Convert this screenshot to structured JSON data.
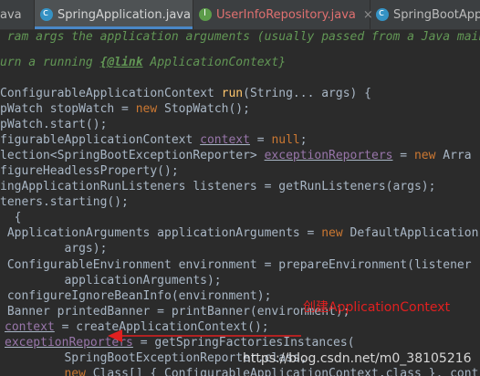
{
  "tabs": [
    {
      "label": "ava",
      "active": false
    },
    {
      "label": "SpringApplication.java",
      "active": true,
      "close": "×"
    },
    {
      "label": "UserInfoRepository.java",
      "active": false,
      "close": "×"
    },
    {
      "label": "SpringBootApplic",
      "active": false
    }
  ],
  "code": {
    "l0": {
      "a": " ram args the application arguments (usually passed from a Java main"
    },
    "l1": {
      "a": "urn a running ",
      "b": "{@link",
      "c": " ApplicationContext}"
    },
    "l2": {
      "a": "ConfigurableApplicationContext ",
      "b": "run",
      "c": "(String... args) {"
    },
    "l3": {
      "a": "pWatch stopWatch = ",
      "b": "new",
      "c": " StopWatch();"
    },
    "l4": {
      "a": "pWatch.start();"
    },
    "l5": {
      "a": "figurableApplicationContext ",
      "b": "context",
      "c": " = ",
      "d": "null",
      "e": ";"
    },
    "l6": {
      "a": "lection<SpringBootExceptionReporter> ",
      "b": "exceptionReporters",
      "c": " = ",
      "d": "new",
      "e": " Arra"
    },
    "l7": {
      "a": "figureHeadlessProperty();"
    },
    "l8": {
      "a": "ingApplicationRunListeners listeners = getRunListeners(args);"
    },
    "l9": {
      "a": "teners.starting();"
    },
    "l10": {
      "a": "  {"
    },
    "l11": {
      "a": " ApplicationArguments applicationArguments = ",
      "b": "new",
      "c": " DefaultApplication"
    },
    "l12": {
      "a": "         args);"
    },
    "l13": {
      "a": " ConfigurableEnvironment environment = prepareEnvironment(listener"
    },
    "l14": {
      "a": "         applicationArguments);"
    },
    "l15": {
      "a": " configureIgnoreBeanInfo(environment);"
    },
    "l16": {
      "a": " Banner printedBanner = printBanner(environment);"
    },
    "l17": {
      "a": "context",
      "b": " = createApplicationContext();"
    },
    "l18": {
      "a": "exceptionReporters",
      "b": " = getSpringFactoriesInstances("
    },
    "l19": {
      "a": "         SpringBootExceptionReporter.class,"
    },
    "l20": {
      "a": "         ",
      "b": "new",
      "c": " Class[] { ConfigurableApplicationContext.class }, cont"
    }
  },
  "annotation": "创建ApplicationContext",
  "watermark": "https://blog.csdn.net/m0_38105216",
  "colors": {
    "background": "#2b2b2b",
    "keyword": "#cc7832",
    "method": "#ffc66d",
    "field": "#9876aa",
    "comment": "#629755",
    "text": "#a9b7c6",
    "annotation": "#e02020"
  }
}
